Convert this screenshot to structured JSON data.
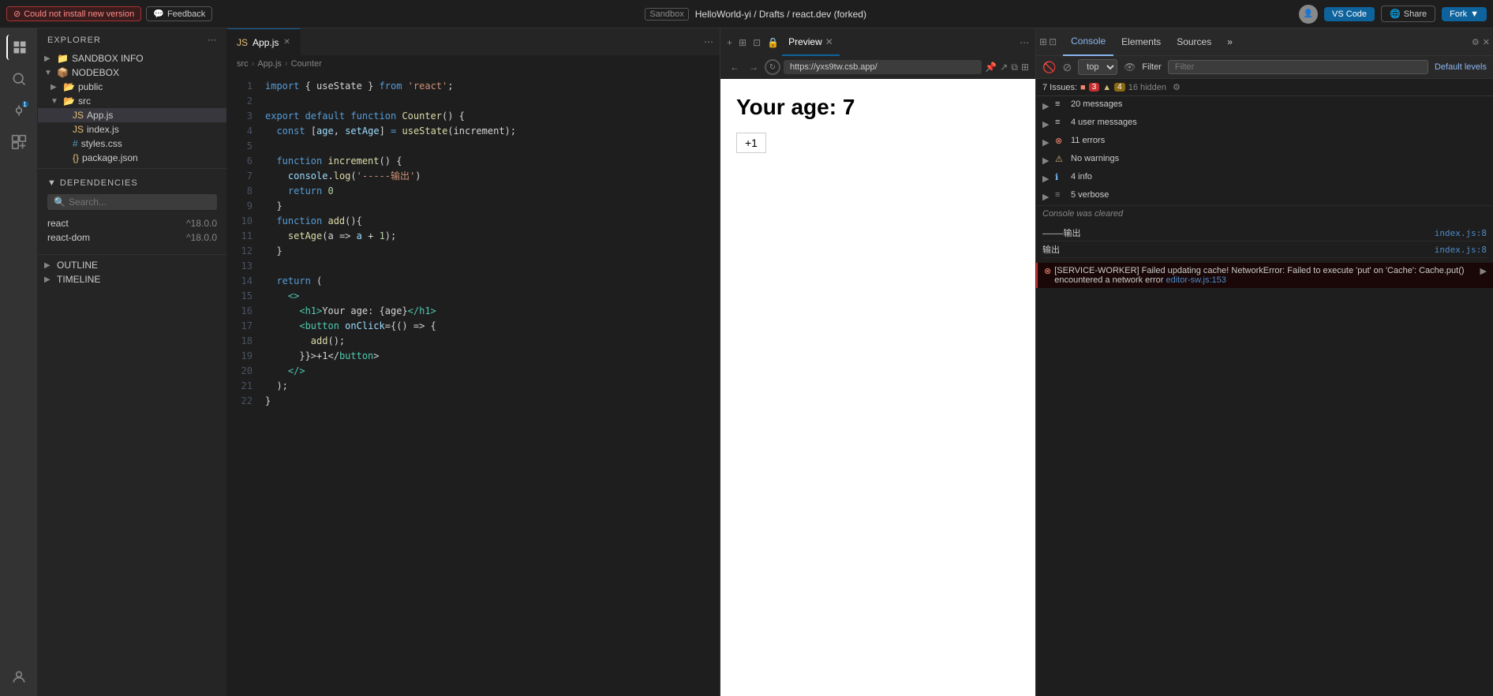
{
  "topbar": {
    "error_label": "Could not install new version",
    "feedback_label": "Feedback",
    "sandbox_label": "Sandbox",
    "project_name": "HelloWorld-yi / Drafts / react.dev (forked)",
    "vs_code_label": "VS Code",
    "share_label": "Share",
    "fork_label": "Fork"
  },
  "explorer": {
    "title": "EXPLORER",
    "sections": {
      "sandbox_info": "SANDBOX INFO",
      "nodebox": "NODEBOX",
      "public": "public",
      "src": "src",
      "files": [
        {
          "name": "App.js",
          "type": "js",
          "active": true
        },
        {
          "name": "index.js",
          "type": "js"
        },
        {
          "name": "styles.css",
          "type": "css"
        },
        {
          "name": "package.json",
          "type": "json"
        }
      ]
    },
    "deps_label": "DEPENDENCIES",
    "search_placeholder": "Search...",
    "deps": [
      {
        "name": "react",
        "version": "^18.0.0"
      },
      {
        "name": "react-dom",
        "version": "^18.0.0"
      }
    ],
    "outline_label": "OUTLINE",
    "timeline_label": "TIMELINE"
  },
  "editor": {
    "tab_label": "App.js",
    "breadcrumb": [
      "src",
      "App.js",
      "Counter"
    ],
    "lines": [
      {
        "num": 1,
        "code_html": "<span class='kw'>import</span> <span class='punct'>{ useState }</span> <span class='kw'>from</span> <span class='str'>'react'</span><span class='punct'>;</span>"
      },
      {
        "num": 2,
        "code_html": ""
      },
      {
        "num": 3,
        "code_html": "<span class='kw'>export default function</span> <span class='fn'>Counter</span><span class='punct'>() {</span>"
      },
      {
        "num": 4,
        "code_html": "  <span class='kw'>const</span> <span class='punct'>[</span><span class='var'>age</span><span class='punct'>,</span> <span class='var'>setAge</span><span class='punct'>]</span> <span class='kw'>=</span> <span class='fn'>useState</span><span class='punct'>(increment);</span>"
      },
      {
        "num": 5,
        "code_html": ""
      },
      {
        "num": 6,
        "code_html": "  <span class='kw'>function</span> <span class='fn'>increment</span><span class='punct'>() {</span>"
      },
      {
        "num": 7,
        "code_html": "    <span class='var'>console</span><span class='punct'>.</span><span class='fn'>log</span><span class='punct'>(</span><span class='str'>'-----输出'</span><span class='punct'>)</span>"
      },
      {
        "num": 8,
        "code_html": "    <span class='kw'>return</span> <span class='num'>0</span>"
      },
      {
        "num": 9,
        "code_html": "  <span class='punct'>}</span>"
      },
      {
        "num": 10,
        "code_html": "  <span class='kw'>function</span> <span class='fn'>add</span><span class='punct'>(){</span>"
      },
      {
        "num": 11,
        "code_html": "    <span class='fn'>setAge</span><span class='punct'>(a =></span> <span class='var'>a</span> <span class='punct'>+</span> <span class='num'>1</span><span class='punct'>);</span>"
      },
      {
        "num": 12,
        "code_html": "  <span class='punct'>}</span>"
      },
      {
        "num": 13,
        "code_html": ""
      },
      {
        "num": 14,
        "code_html": "  <span class='kw'>return</span> <span class='punct'>(</span>"
      },
      {
        "num": 15,
        "code_html": "    <span class='tag'>&lt;&gt;</span>"
      },
      {
        "num": 16,
        "code_html": "      <span class='tag'>&lt;h1&gt;</span><span class='punct'>Your age: {age}</span><span class='tag'>&lt;/h1&gt;</span>"
      },
      {
        "num": 17,
        "code_html": "      <span class='tag'>&lt;button</span> <span class='attr'>onClick</span><span class='punct'>={</span><span class='punct'>() =></span> <span class='punct'>{</span>"
      },
      {
        "num": 18,
        "code_html": "        <span class='fn'>add</span><span class='punct'>();</span>"
      },
      {
        "num": 19,
        "code_html": "      <span class='punct'>}}&gt;+1&lt;/</span><span class='tag'>button</span><span class='punct'>&gt;</span>"
      },
      {
        "num": 20,
        "code_html": "    <span class='tag'>&lt;/&gt;</span>"
      },
      {
        "num": 21,
        "code_html": "  <span class='punct'>);</span>"
      },
      {
        "num": 22,
        "code_html": "<span class='punct'>}</span>"
      }
    ]
  },
  "preview": {
    "tab_label": "Preview",
    "url": "https://yxs9tw.csb.app/",
    "heading": "Your age: 7",
    "button_label": "+1"
  },
  "devtools": {
    "tabs": [
      {
        "label": "Console",
        "active": true
      },
      {
        "label": "Elements"
      },
      {
        "label": "Sources"
      },
      {
        "label": "»"
      }
    ],
    "top_label": "top",
    "filter_placeholder": "Filter",
    "default_levels_label": "Default levels",
    "issues_label": "7 Issues:",
    "error_count": "3",
    "warn_count": "4",
    "hidden_count": "16 hidden",
    "console_rows": [
      {
        "type": "messages",
        "label": "20 messages",
        "count": ""
      },
      {
        "type": "user",
        "label": "4 user messages",
        "count": ""
      },
      {
        "type": "error",
        "label": "11 errors",
        "count": ""
      },
      {
        "type": "warning",
        "label": "No warnings",
        "count": ""
      },
      {
        "type": "info",
        "label": "4 info",
        "count": ""
      },
      {
        "type": "verbose",
        "label": "5 verbose",
        "count": ""
      }
    ],
    "console_cleared": "Console was cleared",
    "log1_text": "——输出",
    "log1_file": "index.js:8",
    "log2_text": "输出",
    "log2_file": "index.js:8",
    "service_worker_msg": "[SERVICE-WORKER] Failed updating cache! NetworkError: Failed to execute 'put' on 'Cache': Cache.put() encountered a network error",
    "sw_file": "editor-sw.js:153"
  }
}
